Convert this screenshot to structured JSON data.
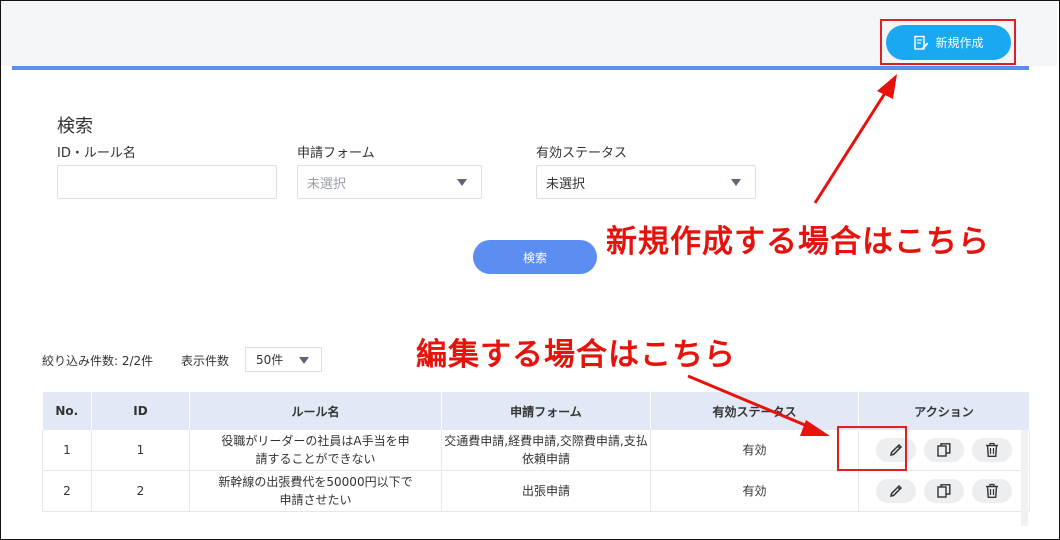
{
  "header": {
    "new_button_label": "新規作成"
  },
  "annotations": {
    "new_hint": "新規作成する場合はこちら",
    "edit_hint": "編集する場合はこちら"
  },
  "search": {
    "title": "検索",
    "id_rule_label": "ID・ルール名",
    "id_rule_value": "",
    "form_label": "申請フォーム",
    "form_value": "未選択",
    "status_label": "有効ステータス",
    "status_value": "未選択",
    "button_label": "検索"
  },
  "list": {
    "count_text": "絞り込み件数: 2/2件",
    "per_page_label": "表示件数",
    "per_page_value": "50件"
  },
  "table": {
    "headers": [
      "No.",
      "ID",
      "ルール名",
      "申請フォーム",
      "有効ステータス",
      "アクション"
    ],
    "rows": [
      {
        "no": "1",
        "id": "1",
        "rule_name": "役職がリーダーの社員はA手当を申請することができない",
        "form": "交通費申請,経費申請,交際費申請,支払依頼申請",
        "status": "有効"
      },
      {
        "no": "2",
        "id": "2",
        "rule_name": "新幹線の出張費代を50000円以下で申請させたい",
        "form": "出張申請",
        "status": "有効"
      }
    ]
  },
  "icons": {
    "new": "document-edit-icon",
    "edit": "pencil-icon",
    "copy": "copy-icon",
    "delete": "trash-icon"
  },
  "colors": {
    "accent": "#5b8ef0",
    "new_button": "#1aa8f0",
    "annotation": "#e8120c",
    "table_header": "#e2e8f6"
  }
}
